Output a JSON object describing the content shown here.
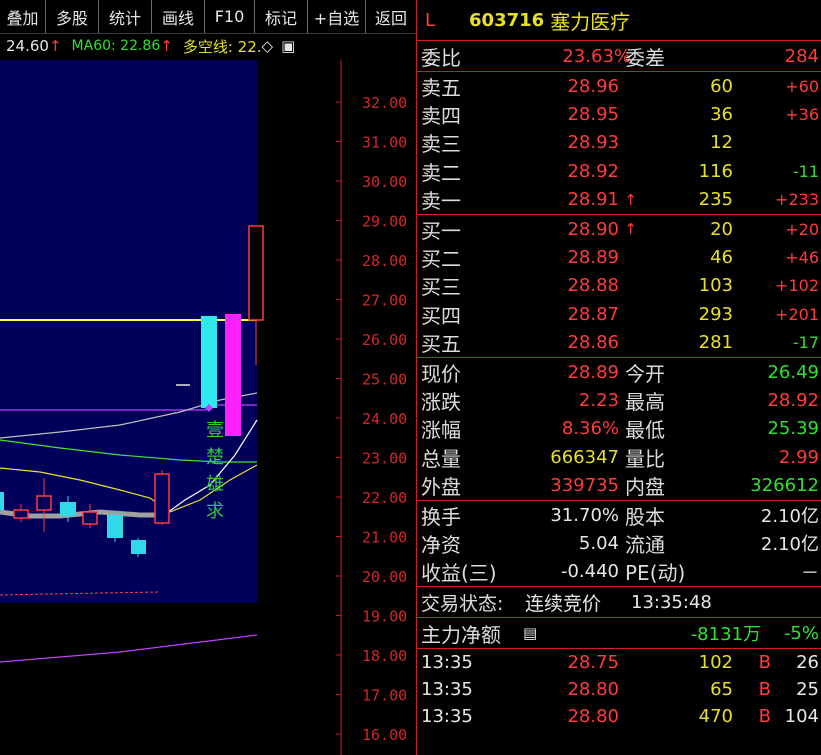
{
  "toolbar": {
    "items": [
      "叠加",
      "多股",
      "统计",
      "画线",
      "F10",
      "标记",
      "+自选",
      "返回"
    ]
  },
  "indicator": {
    "partial_value": "24.60",
    "ma60_label": "MA60: 22.86",
    "duokong_label": "多空线: 22.",
    "arrow_glyph": "↑",
    "diamond_glyph": "◇",
    "square_glyph": "▣"
  },
  "price_axis": {
    "ticks": [
      "32.00",
      "31.00",
      "30.00",
      "29.00",
      "28.00",
      "27.00",
      "26.00",
      "25.00",
      "24.00",
      "23.00",
      "22.00",
      "21.00",
      "20.00",
      "19.00",
      "18.00",
      "17.00",
      "16.00"
    ]
  },
  "annotation": {
    "chars": [
      "壹",
      "楚",
      "雄",
      "求"
    ]
  },
  "stock": {
    "market_flag": "L",
    "code": "603716",
    "name": "塞力医疗"
  },
  "ratio": {
    "wei_bi_label": "委比",
    "wei_bi_value": "23.63%",
    "wei_cha_label": "委差",
    "wei_cha_value": "284"
  },
  "asks": [
    {
      "label": "卖五",
      "price": "28.96",
      "arrow": "",
      "volume": "60",
      "change": "+60"
    },
    {
      "label": "卖四",
      "price": "28.95",
      "arrow": "",
      "volume": "36",
      "change": "+36"
    },
    {
      "label": "卖三",
      "price": "28.93",
      "arrow": "",
      "volume": "12",
      "change": ""
    },
    {
      "label": "卖二",
      "price": "28.92",
      "arrow": "",
      "volume": "116",
      "change": "-11"
    },
    {
      "label": "卖一",
      "price": "28.91",
      "arrow": "↑",
      "volume": "235",
      "change": "+233"
    }
  ],
  "bids": [
    {
      "label": "买一",
      "price": "28.90",
      "arrow": "↑",
      "volume": "20",
      "change": "+20"
    },
    {
      "label": "买二",
      "price": "28.89",
      "arrow": "",
      "volume": "46",
      "change": "+46"
    },
    {
      "label": "买三",
      "price": "28.88",
      "arrow": "",
      "volume": "103",
      "change": "+102"
    },
    {
      "label": "买四",
      "price": "28.87",
      "arrow": "",
      "volume": "293",
      "change": "+201"
    },
    {
      "label": "买五",
      "price": "28.86",
      "arrow": "",
      "volume": "281",
      "change": "-17"
    }
  ],
  "stats": [
    {
      "l1": "现价",
      "v1": "28.89",
      "l2": "今开",
      "v2": "26.49"
    },
    {
      "l1": "涨跌",
      "v1": "2.23",
      "l2": "最高",
      "v2": "28.92"
    },
    {
      "l1": "涨幅",
      "v1": "8.36%",
      "l2": "最低",
      "v2": "25.39"
    },
    {
      "l1": "总量",
      "v1": "666347",
      "l2": "量比",
      "v2": "2.99"
    },
    {
      "l1": "外盘",
      "v1": "339735",
      "l2": "内盘",
      "v2": "326612"
    }
  ],
  "fundamentals": [
    {
      "l1": "换手",
      "v1": "31.70%",
      "l2": "股本",
      "v2": "2.10亿"
    },
    {
      "l1": "净资",
      "v1": "5.04",
      "l2": "流通",
      "v2": "2.10亿"
    },
    {
      "l1": "收益(三)",
      "v1": "-0.440",
      "l2": "PE(动)",
      "v2": "－"
    }
  ],
  "trade_status": {
    "label": "交易状态:",
    "value": "连续竞价",
    "time": "13:35:48"
  },
  "main_flow": {
    "label": "主力净额",
    "amount": "-8131万",
    "percent": "-5%"
  },
  "ticks": [
    {
      "time": "13:35",
      "price": "28.75",
      "volume": "102",
      "side": "B",
      "count": "26"
    },
    {
      "time": "13:35",
      "price": "28.80",
      "volume": "65",
      "side": "B",
      "count": "25"
    },
    {
      "time": "13:35",
      "price": "28.80",
      "volume": "470",
      "side": "B",
      "count": "104"
    }
  ],
  "colors": {
    "up": "#ff3b3b",
    "down": "#2fe030",
    "volume": "#e8e028",
    "border": "#cc2020",
    "chart_bg": "#00005a"
  }
}
